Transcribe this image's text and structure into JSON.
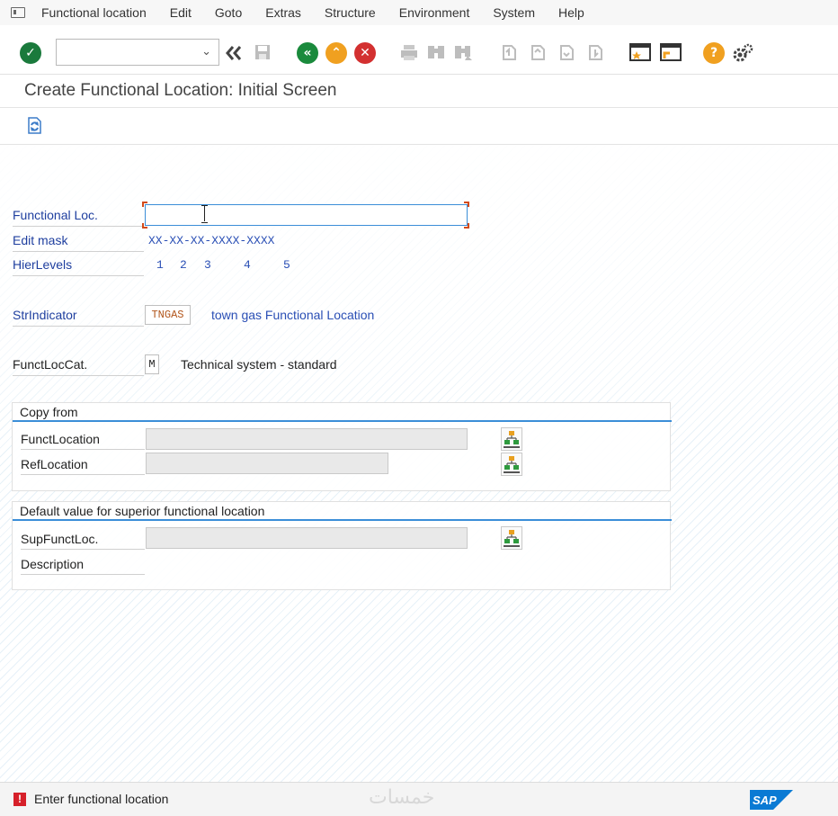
{
  "menubar": {
    "items": [
      {
        "label": "Functional location"
      },
      {
        "label": "Edit"
      },
      {
        "label": "Goto"
      },
      {
        "label": "Extras"
      },
      {
        "label": "Structure"
      },
      {
        "label": "Environment"
      },
      {
        "label": "System"
      },
      {
        "label": "Help"
      }
    ]
  },
  "toolbar": {
    "command_field_value": "",
    "icons": [
      "enter-icon",
      "back-double-icon",
      "save-icon",
      "back-icon",
      "exit-icon",
      "cancel-icon",
      "print-icon",
      "find-icon",
      "find-next-icon",
      "first-page-icon",
      "previous-page-icon",
      "next-page-icon",
      "last-page-icon",
      "create-session-icon",
      "shortcut-icon",
      "help-icon",
      "settings-icon"
    ]
  },
  "title": "Create Functional Location: Initial Screen",
  "form": {
    "functional_loc": {
      "label": "Functional Loc.",
      "value": ""
    },
    "edit_mask": {
      "label": "Edit mask",
      "value": "XX-XX-XX-XXXX-XXXX"
    },
    "hier_levels": {
      "label": "HierLevels",
      "values": [
        "1",
        "2",
        "3",
        "4",
        "5"
      ]
    },
    "str_indicator": {
      "label": "StrIndicator",
      "value": "TNGAS",
      "description": "town gas Functional Location"
    },
    "funct_loc_cat": {
      "label": "FunctLocCat.",
      "value": "M",
      "description": "Technical system - standard"
    }
  },
  "copy_from": {
    "title": "Copy from",
    "funct_location": {
      "label": "FunctLocation",
      "value": ""
    },
    "ref_location": {
      "label": "RefLocation",
      "value": ""
    }
  },
  "superior": {
    "title": "Default value for superior functional location",
    "sup_funct_loc": {
      "label": "SupFunctLoc.",
      "value": ""
    },
    "description": {
      "label": "Description"
    }
  },
  "status": {
    "type": "error",
    "message": "Enter functional location",
    "watermark": "خمسات",
    "logo": "SAP"
  },
  "colors": {
    "label_blue": "#1f3f9f",
    "accent_blue": "#3b8ed8",
    "error_red": "#d6202a",
    "ok_green": "#1a7a3c",
    "back_green": "#1a8a3c",
    "exit_orange": "#f0a020",
    "cancel_red": "#d33030",
    "sap_blue": "#0a7ad4"
  }
}
